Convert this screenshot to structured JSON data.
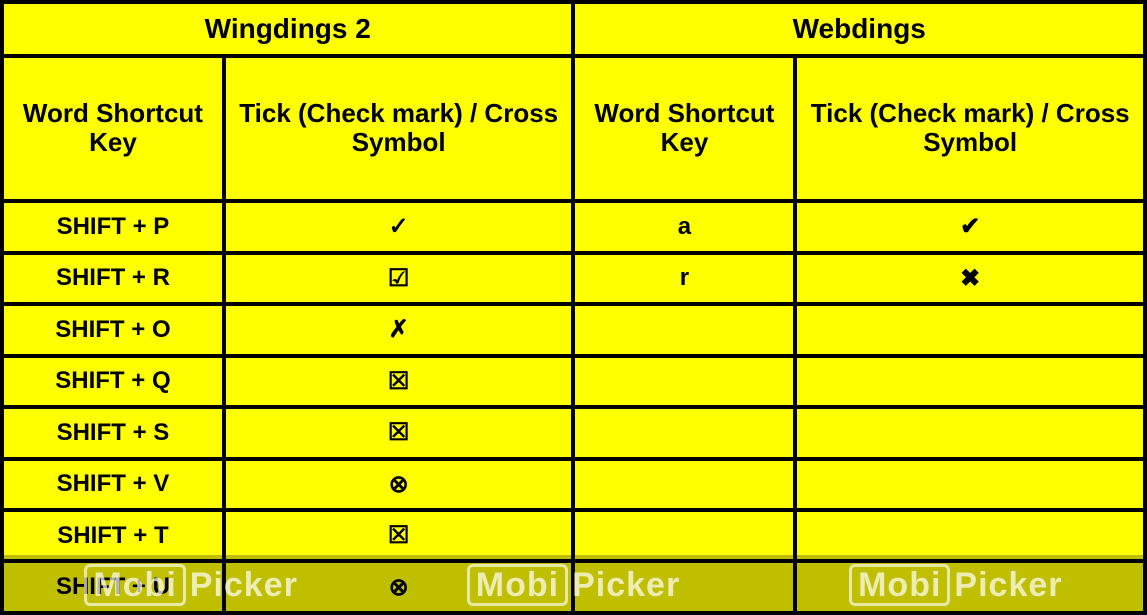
{
  "chart_data": {
    "type": "table",
    "sections": [
      {
        "title": "Wingdings 2",
        "columns": [
          "Word Shortcut Key",
          "Tick (Check mark) / Cross Symbol"
        ],
        "rows": [
          {
            "shortcut": "SHIFT + P",
            "symbol": "✓"
          },
          {
            "shortcut": "SHIFT + R",
            "symbol": "☑"
          },
          {
            "shortcut": "SHIFT + O",
            "symbol": "✗"
          },
          {
            "shortcut": "SHIFT + Q",
            "symbol": "☒"
          },
          {
            "shortcut": "SHIFT + S",
            "symbol": "☒"
          },
          {
            "shortcut": "SHIFT + V",
            "symbol": "⊗"
          },
          {
            "shortcut": "SHIFT + T",
            "symbol": "☒"
          },
          {
            "shortcut": "SHIFT + U",
            "symbol": "⊗"
          }
        ]
      },
      {
        "title": "Webdings",
        "columns": [
          "Word Shortcut Key",
          "Tick (Check mark) / Cross Symbol"
        ],
        "rows": [
          {
            "shortcut": "a",
            "symbol": "✔"
          },
          {
            "shortcut": "r",
            "symbol": "✖"
          },
          {
            "shortcut": "",
            "symbol": ""
          },
          {
            "shortcut": "",
            "symbol": ""
          },
          {
            "shortcut": "",
            "symbol": ""
          },
          {
            "shortcut": "",
            "symbol": ""
          },
          {
            "shortcut": "",
            "symbol": ""
          },
          {
            "shortcut": "",
            "symbol": ""
          }
        ]
      }
    ]
  },
  "watermark": {
    "brand_box": "Mobi",
    "brand_rest": "Picker"
  }
}
